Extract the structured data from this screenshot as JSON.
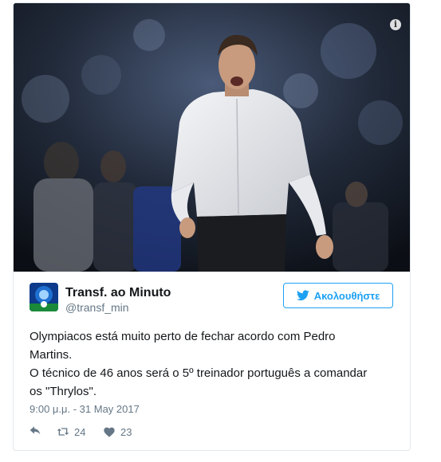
{
  "tweet": {
    "author_name": "Transf. ao Minuto",
    "author_handle": "@transf_min",
    "follow_label": "Ακολουθήστε",
    "text_lines": [
      "Olympiacos está muito perto de fechar acordo com Pedro",
      "Martins.",
      "O técnico de 46 anos será o 5º treinador português a comandar",
      "os \"Thrylos\"."
    ],
    "timestamp": "9:00 μ.μ. - 31 May 2017",
    "retweet_count": "24",
    "like_count": "23"
  },
  "media": {
    "info_icon": "info-icon",
    "info_label": "i"
  },
  "icons": {
    "follow": "twitter-bird-icon",
    "reply": "reply-icon",
    "retweet": "retweet-icon",
    "like": "heart-icon"
  },
  "colors": {
    "accent": "#1da1f2",
    "text": "#14171a",
    "muted": "#657786",
    "border": "#e1e8ed"
  }
}
